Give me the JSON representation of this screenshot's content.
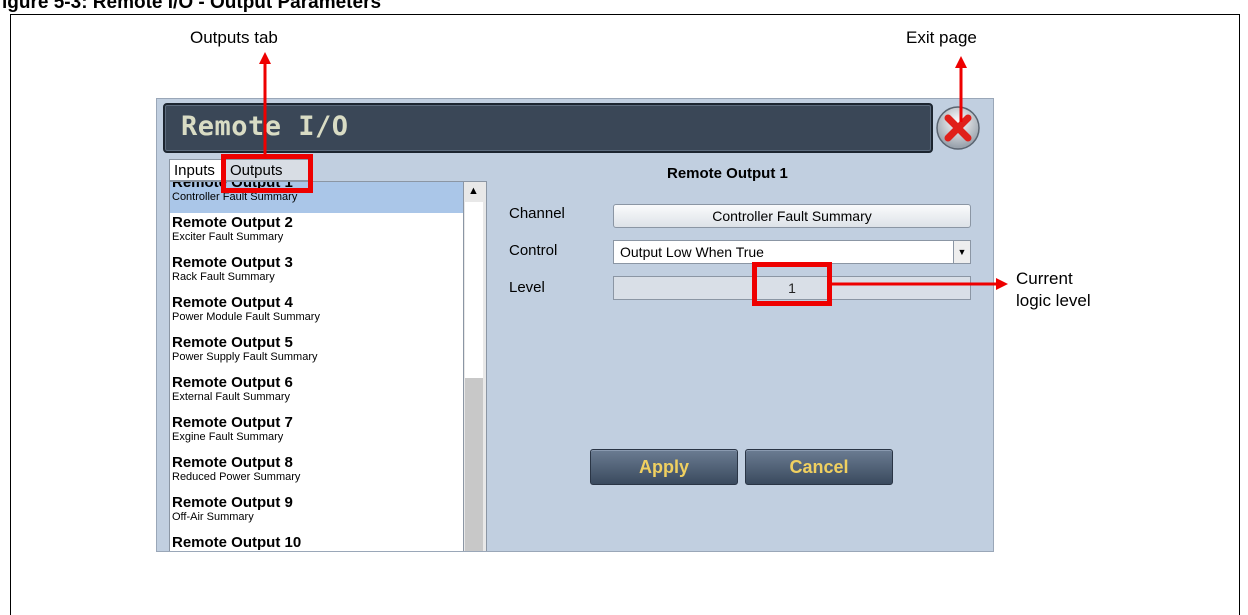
{
  "figure": {
    "caption": "igure 5-3: Remote I/O - Output Parameters"
  },
  "annotations": {
    "outputs_tab": "Outputs tab",
    "exit_page": "Exit page",
    "current_logic_level_1": "Current",
    "current_logic_level_2": "logic level"
  },
  "panel": {
    "title": "Remote I/O",
    "tabs": [
      {
        "label": "Inputs"
      },
      {
        "label": "Outputs",
        "active": true
      }
    ],
    "list": [
      {
        "title": "Remote Output 1",
        "subtitle": "Controller Fault Summary",
        "selected": true
      },
      {
        "title": "Remote Output 2",
        "subtitle": "Exciter Fault Summary"
      },
      {
        "title": "Remote Output 3",
        "subtitle": "Rack Fault Summary"
      },
      {
        "title": "Remote Output 4",
        "subtitle": "Power Module Fault Summary"
      },
      {
        "title": "Remote Output 5",
        "subtitle": "Power Supply Fault Summary"
      },
      {
        "title": "Remote Output 6",
        "subtitle": "External Fault Summary"
      },
      {
        "title": "Remote Output 7",
        "subtitle": "Exgine Fault Summary"
      },
      {
        "title": "Remote Output 8",
        "subtitle": "Reduced Power Summary"
      },
      {
        "title": "Remote Output 9",
        "subtitle": "Off-Air Summary"
      },
      {
        "title": "Remote Output 10",
        "subtitle": ""
      }
    ],
    "detail": {
      "heading": "Remote Output 1",
      "channel_label": "Channel",
      "channel_value": "Controller Fault Summary",
      "control_label": "Control",
      "control_value": "Output Low When True",
      "level_label": "Level",
      "level_value": "1"
    },
    "buttons": {
      "apply": "Apply",
      "cancel": "Cancel"
    }
  },
  "colors": {
    "highlight": "#ee0000",
    "panel_bg": "#c1cfe0",
    "title_bar": "#3a4757",
    "button_text": "#f0d060"
  }
}
